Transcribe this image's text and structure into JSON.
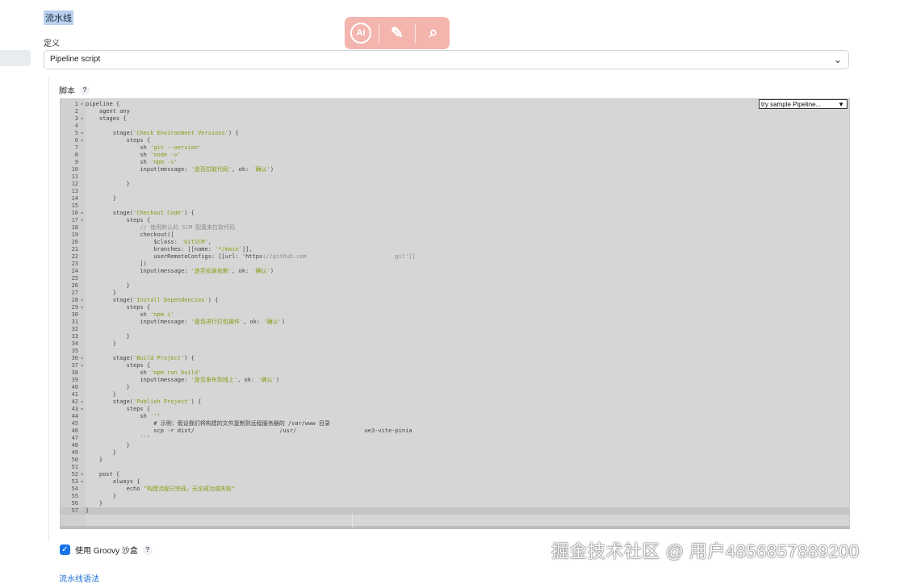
{
  "pipeline": {
    "section_title": "流水线",
    "definition_label": "定义",
    "definition_value": "Pipeline script",
    "script_label": "脚本",
    "help_glyph": "?",
    "sample_select": "try sample Pipeline...",
    "groovy_sandbox_label": "使用 Groovy 沙盒",
    "bottom_link": "流水线语法"
  },
  "toolbar": {
    "ai_label": "AI",
    "magic_icon": "✎",
    "search_icon": "⌕"
  },
  "watermark": "掘金技术社区 @ 用户4856857889200",
  "code": [
    {
      "n": "1",
      "f": "▾",
      "t": "pipeline {"
    },
    {
      "n": "2",
      "f": "",
      "t": "    agent any"
    },
    {
      "n": "3",
      "f": "▾",
      "t": "    stages {"
    },
    {
      "n": "4",
      "f": "",
      "t": ""
    },
    {
      "n": "5",
      "f": "▾",
      "t": "        stage('Check Environment Versions') {"
    },
    {
      "n": "6",
      "f": "▾",
      "t": "            steps {"
    },
    {
      "n": "7",
      "f": "",
      "t": "                sh 'git --version'"
    },
    {
      "n": "8",
      "f": "",
      "t": "                sh 'node -v'"
    },
    {
      "n": "9",
      "f": "",
      "t": "                sh 'npm -v'"
    },
    {
      "n": "10",
      "f": "",
      "t": "                input(message: '是否拉取代码', ok: '确认')"
    },
    {
      "n": "11",
      "f": "",
      "t": ""
    },
    {
      "n": "12",
      "f": "",
      "t": "            }"
    },
    {
      "n": "13",
      "f": "",
      "t": ""
    },
    {
      "n": "14",
      "f": "",
      "t": "        }"
    },
    {
      "n": "15",
      "f": "",
      "t": ""
    },
    {
      "n": "16",
      "f": "▾",
      "t": "        stage('Checkout Code') {"
    },
    {
      "n": "17",
      "f": "▾",
      "t": "            steps {"
    },
    {
      "n": "18",
      "f": "",
      "t": "                // 使用默认的 SCM 配置来拉取代码"
    },
    {
      "n": "19",
      "f": "",
      "t": "                checkout(["
    },
    {
      "n": "20",
      "f": "",
      "t": "                    $class: 'GitSCM',"
    },
    {
      "n": "21",
      "f": "",
      "t": "                    branches: [[name: '*/main']],"
    },
    {
      "n": "22",
      "f": "",
      "t": "                    userRemoteConfigs: [[url: 'https://github.com                          git']]"
    },
    {
      "n": "23",
      "f": "",
      "t": "                ])"
    },
    {
      "n": "24",
      "f": "",
      "t": "                input(message: '是否安装依赖', ok: '确认')"
    },
    {
      "n": "25",
      "f": "",
      "t": ""
    },
    {
      "n": "26",
      "f": "",
      "t": "            }"
    },
    {
      "n": "27",
      "f": "",
      "t": "        }"
    },
    {
      "n": "28",
      "f": "▾",
      "t": "        stage('Install Dependencies') {"
    },
    {
      "n": "29",
      "f": "▾",
      "t": "            steps {"
    },
    {
      "n": "30",
      "f": "",
      "t": "                sh 'npm i'"
    },
    {
      "n": "31",
      "f": "",
      "t": "                input(message: '是否进行打包操作', ok: '确认')"
    },
    {
      "n": "32",
      "f": "",
      "t": ""
    },
    {
      "n": "33",
      "f": "",
      "t": "            }"
    },
    {
      "n": "34",
      "f": "",
      "t": "        }"
    },
    {
      "n": "35",
      "f": "",
      "t": ""
    },
    {
      "n": "36",
      "f": "▾",
      "t": "        stage('Build Project') {"
    },
    {
      "n": "37",
      "f": "▾",
      "t": "            steps {"
    },
    {
      "n": "38",
      "f": "",
      "t": "                sh 'npm run build'"
    },
    {
      "n": "39",
      "f": "",
      "t": "                input(message: '是否发布到线上', ok: '确认')"
    },
    {
      "n": "40",
      "f": "",
      "t": "            }"
    },
    {
      "n": "41",
      "f": "",
      "t": "        }"
    },
    {
      "n": "42",
      "f": "▾",
      "t": "        stage('Publish Project') {"
    },
    {
      "n": "43",
      "f": "▾",
      "t": "            steps {"
    },
    {
      "n": "44",
      "f": "",
      "t": "                sh '''"
    },
    {
      "n": "45",
      "f": "",
      "t": "                    # 示例：假设我们将构建的文件复制到远程服务器的 /var/www 目录"
    },
    {
      "n": "46",
      "f": "",
      "t": "                    scp -r dist/                         /usr/                    ue3-vite-pinia"
    },
    {
      "n": "47",
      "f": "",
      "t": "                '''"
    },
    {
      "n": "48",
      "f": "",
      "t": "            }"
    },
    {
      "n": "49",
      "f": "",
      "t": "        }"
    },
    {
      "n": "50",
      "f": "",
      "t": "    }"
    },
    {
      "n": "51",
      "f": "",
      "t": ""
    },
    {
      "n": "52",
      "f": "▾",
      "t": "    post {"
    },
    {
      "n": "53",
      "f": "▾",
      "t": "        always {"
    },
    {
      "n": "54",
      "f": "",
      "t": "            echo \"构建流程已完成，无论成功或失败\""
    },
    {
      "n": "55",
      "f": "",
      "t": "        }"
    },
    {
      "n": "56",
      "f": "",
      "t": "    }"
    },
    {
      "n": "57",
      "f": "",
      "t": "}"
    }
  ]
}
